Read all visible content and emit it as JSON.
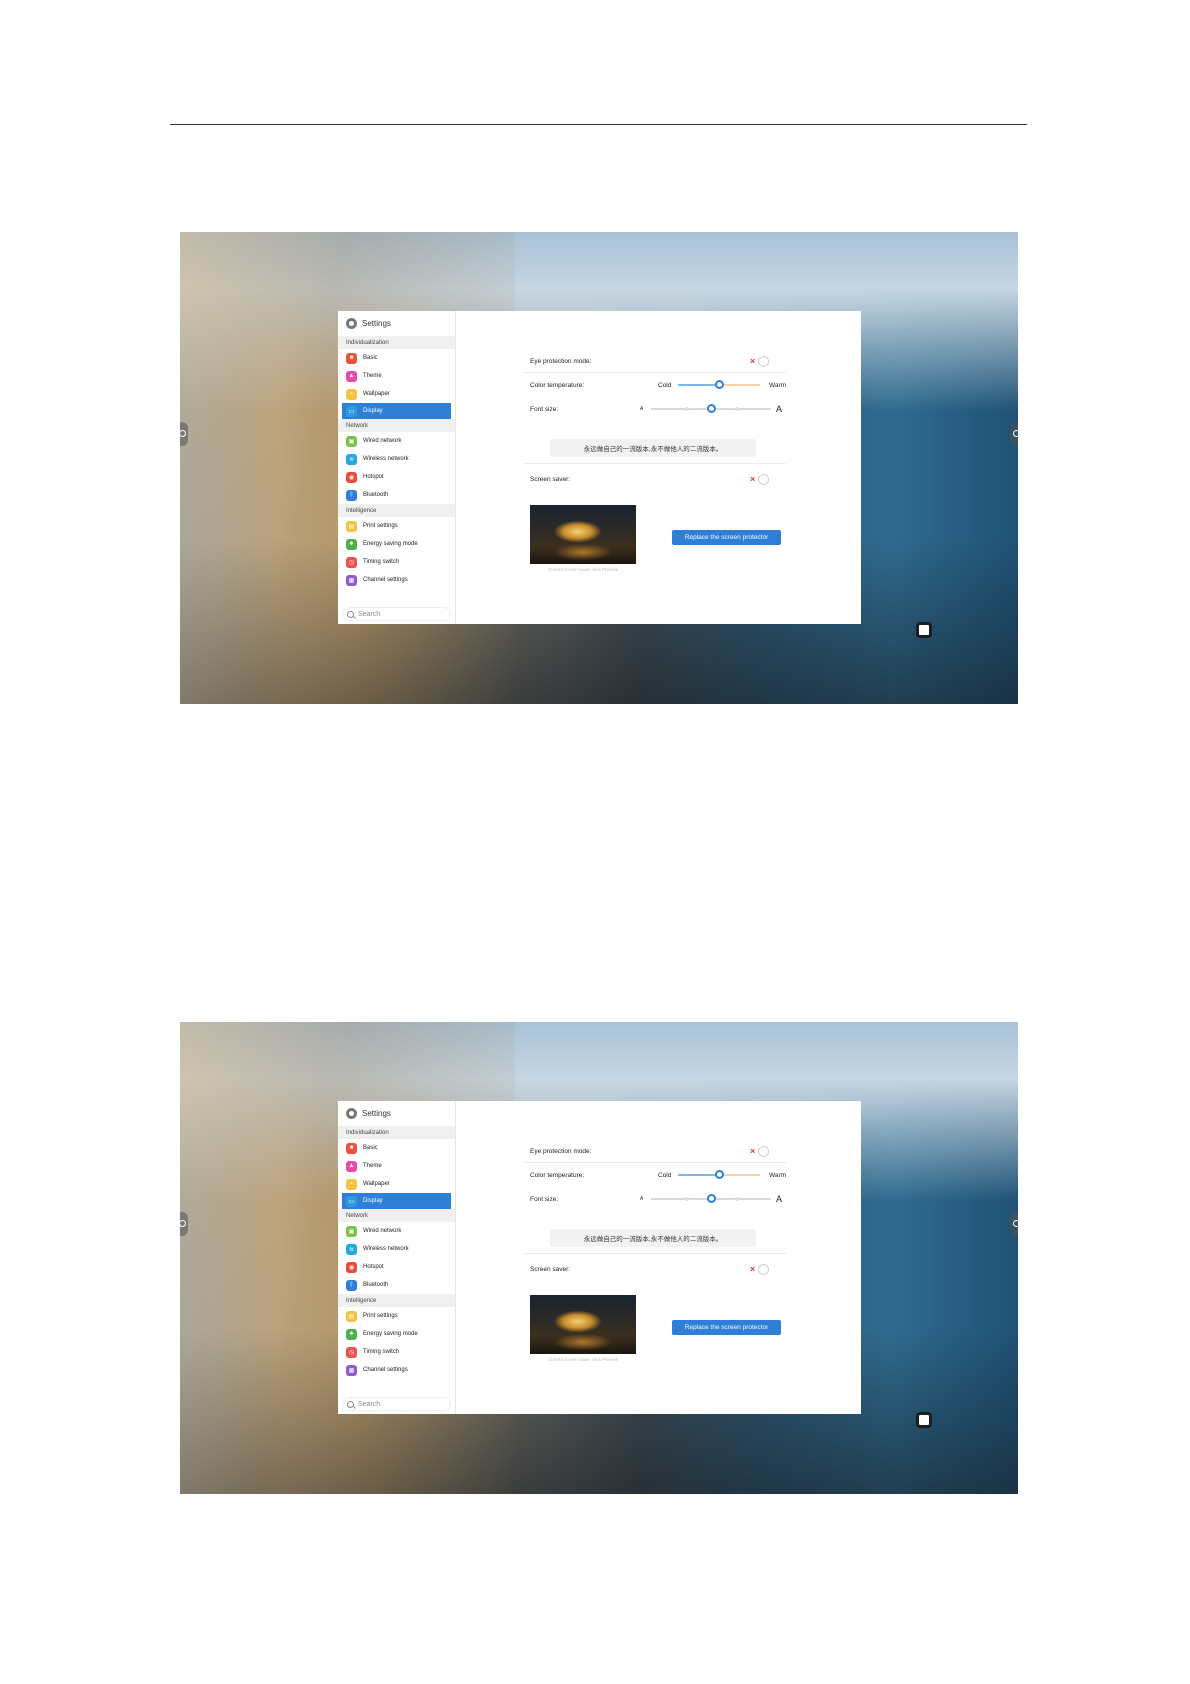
{
  "settings": {
    "title": "Settings",
    "sections": {
      "individualization": "Individualization",
      "network": "Network",
      "intelligence": "Intelligence"
    },
    "items": {
      "basic": "Basic",
      "theme": "Theme",
      "wallpaper": "Wallpaper",
      "display": "Display",
      "wired_network": "Wired network",
      "wireless_network": "Wireless network",
      "hotspot": "Hotspot",
      "bluetooth": "Bluetooth",
      "print_settings": "Print settings",
      "energy_saving_mode": "Energy saving mode",
      "timing_switch": "Timing switch",
      "channel_settings": "Channel settings"
    },
    "search_placeholder": "Search",
    "selected_item": "Display",
    "colors": {
      "accent": "#2d7fd8",
      "off_x": "#e53935",
      "basic": "#f0513b",
      "theme": "#e94aa8",
      "wallpaper": "#f5c342",
      "display": "#2d9be0",
      "wired_network": "#7cc34a",
      "wireless_network": "#23a9e1",
      "hotspot": "#ef4b3a",
      "bluetooth": "#2d7fd8",
      "print_settings": "#f5c342",
      "energy_saving_mode": "#4caf50",
      "timing_switch": "#ef5350",
      "channel_settings": "#8e5bd1"
    },
    "icons": [
      "gear-icon",
      "basic-icon",
      "theme-icon",
      "wallpaper-icon",
      "display-icon",
      "wired-network-icon",
      "wireless-network-icon",
      "hotspot-icon",
      "bluetooth-icon",
      "print-settings-icon",
      "energy-saving-icon",
      "timing-switch-icon",
      "channel-settings-icon",
      "search-icon"
    ]
  },
  "display": {
    "eye_protection_label": "Eye protection mode:",
    "eye_protection_on": false,
    "color_temp_label": "Color temperature:",
    "color_temp_cold": "Cold",
    "color_temp_warm": "Warm",
    "color_temp_value": 0.5,
    "font_size_label": "Font size:",
    "font_size_small": "A",
    "font_size_large": "A",
    "font_size_value": 0.5,
    "preview_text": "永远做自己的一流版本,永不做他人的二流版本。",
    "screen_saver_label": "Screen saver:",
    "screen_saver_on": false,
    "thumbnail_caption": "Current screen saver, click Preview",
    "replace_button": "Replace the screen protector"
  }
}
